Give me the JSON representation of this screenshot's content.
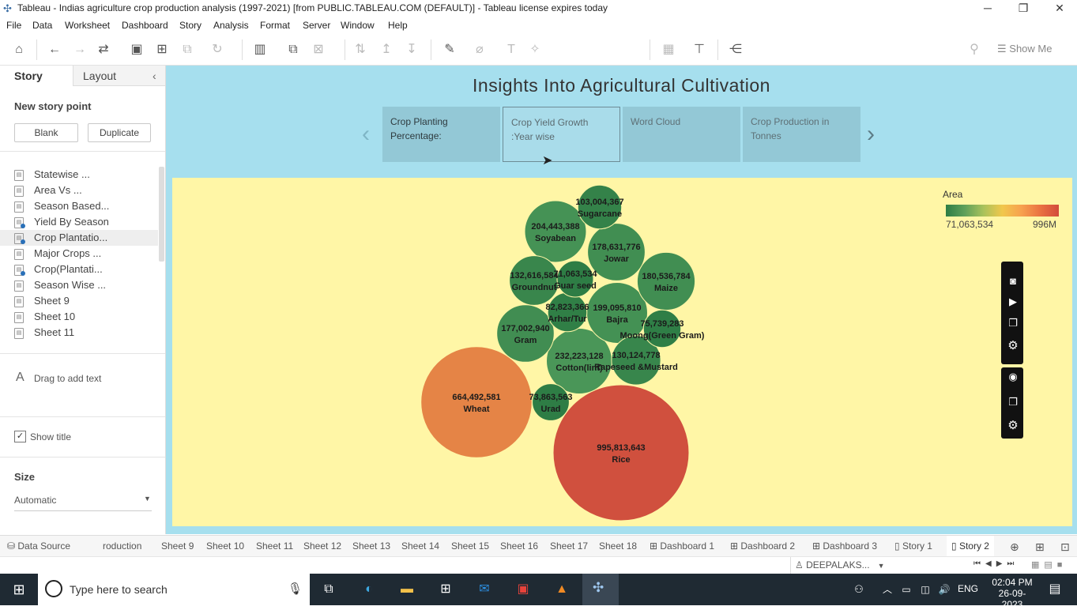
{
  "window": {
    "title": "Tableau - Indias agriculture crop production analysis (1997-2021) [from PUBLIC.TABLEAU.COM (DEFAULT)] - Tableau license expires today"
  },
  "menu": [
    "File",
    "Data",
    "Worksheet",
    "Dashboard",
    "Story",
    "Analysis",
    "Format",
    "Server",
    "Window",
    "Help"
  ],
  "toolbar": {
    "show_me": "Show Me"
  },
  "left_pane": {
    "tab_story": "Story",
    "tab_layout": "Layout",
    "new_story_point": "New story point",
    "blank_button": "Blank",
    "duplicate_button": "Duplicate",
    "sheets": [
      {
        "label": "Statewise ..."
      },
      {
        "label": "Area Vs ..."
      },
      {
        "label": "Season Based..."
      },
      {
        "label": "Yield By Season"
      },
      {
        "label": "Crop Plantatio..."
      },
      {
        "label": "Major Crops ..."
      },
      {
        "label": "Crop(Plantati..."
      },
      {
        "label": "Season Wise ..."
      },
      {
        "label": "Sheet 9"
      },
      {
        "label": "Sheet 10"
      },
      {
        "label": "Sheet 11"
      }
    ],
    "drag_text": "Drag to add text",
    "show_title": "Show title",
    "size_label": "Size",
    "size_value": "Automatic"
  },
  "story": {
    "title": "Insights Into Agricultural Cultivation",
    "points": [
      {
        "line1": "Crop Planting",
        "line2": "Percentage:"
      },
      {
        "line1": "Crop Yield Growth",
        "line2": ":Year wise"
      },
      {
        "line1": "Word Cloud",
        "line2": ""
      },
      {
        "line1": "Crop Production in",
        "line2": "Tonnes"
      }
    ]
  },
  "legend": {
    "title": "Area",
    "min": "71,063,534",
    "max": "996M"
  },
  "chart_data": {
    "type": "bubble",
    "size_and_color_measure": "Area",
    "color_range": [
      "#2e7d45",
      "#f5c842",
      "#f0a04b",
      "#d0503e"
    ],
    "bubbles": [
      {
        "crop": "Sugarcane",
        "area_label": "103,004,367",
        "value": 103004367
      },
      {
        "crop": "Soyabean",
        "area_label": "204,443,388",
        "value": 204443388
      },
      {
        "crop": "Jowar",
        "area_label": "178,631,776",
        "value": 178631776
      },
      {
        "crop": "Groundnut",
        "area_label": "132,616,584",
        "value": 132616584
      },
      {
        "crop": "Guar seed",
        "area_label": "71,063,534",
        "value": 71063534
      },
      {
        "crop": "Maize",
        "area_label": "180,536,784",
        "value": 180536784
      },
      {
        "crop": "Arhar/Tur",
        "area_label": "82,823,366",
        "value": 82823366
      },
      {
        "crop": "Bajra",
        "area_label": "199,095,810",
        "value": 199095810
      },
      {
        "crop": "Gram",
        "area_label": "177,002,940",
        "value": 177002940
      },
      {
        "crop": "Moong(Green Gram)",
        "area_label": "75,739,283",
        "value": 75739283
      },
      {
        "crop": "Cotton(lint)",
        "area_label": "232,223,128",
        "value": 232223128
      },
      {
        "crop": "Rapeseed &Mustard",
        "area_label": "130,124,778",
        "value": 130124778
      },
      {
        "crop": "Wheat",
        "area_label": "664,492,581",
        "value": 664492581
      },
      {
        "crop": "Urad",
        "area_label": "73,863,563",
        "value": 73863563
      },
      {
        "crop": "Rice",
        "area_label": "995,813,643",
        "value": 995813643
      }
    ]
  },
  "sheet_tabs": [
    "Data Source",
    "roduction",
    "Sheet 9",
    "Sheet 10",
    "Sheet 11",
    "Sheet 12",
    "Sheet 13",
    "Sheet 14",
    "Sheet 15",
    "Sheet 16",
    "Sheet 17",
    "Sheet 18",
    "Dashboard 1",
    "Dashboard 2",
    "Dashboard 3",
    "Story 1",
    "Story 2"
  ],
  "status": {
    "user": "DEEPALAKS..."
  },
  "taskbar": {
    "search_placeholder": "Type here to search",
    "lang": "ENG",
    "time": "02:04 PM",
    "date": "26-09-2023"
  }
}
